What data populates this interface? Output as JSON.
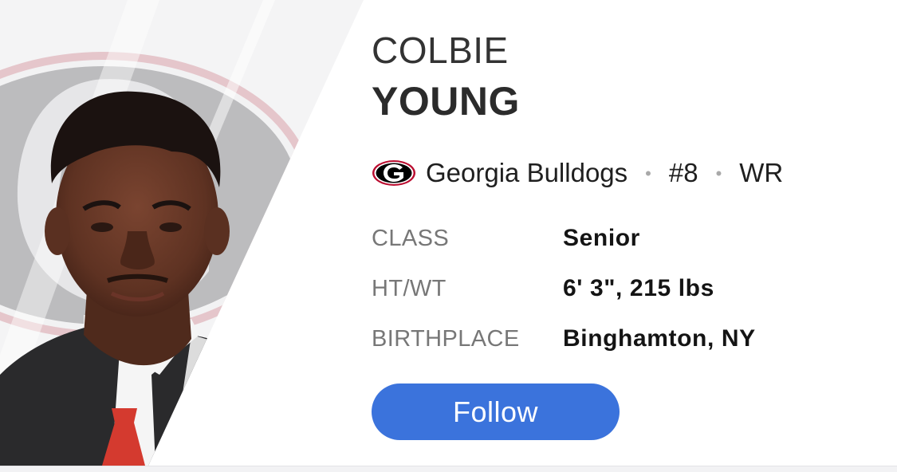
{
  "player": {
    "first_name": "COLBIE",
    "last_name": "YOUNG",
    "photo_alt": "player-headshot"
  },
  "team": {
    "logo_icon": "georgia-g-logo-icon",
    "name": "Georgia Bulldogs",
    "number": "#8",
    "position": "WR",
    "separator": "•"
  },
  "details": [
    {
      "label": "CLASS",
      "value": "Senior"
    },
    {
      "label": "HT/WT",
      "value": "6' 3\", 215 lbs"
    },
    {
      "label": "BIRTHPLACE",
      "value": "Binghamton, NY"
    }
  ],
  "actions": {
    "follow_label": "Follow"
  },
  "colors": {
    "button": "#3b73dc",
    "team_red": "#ba0c2f",
    "team_black": "#000000",
    "label_gray": "#777777"
  }
}
